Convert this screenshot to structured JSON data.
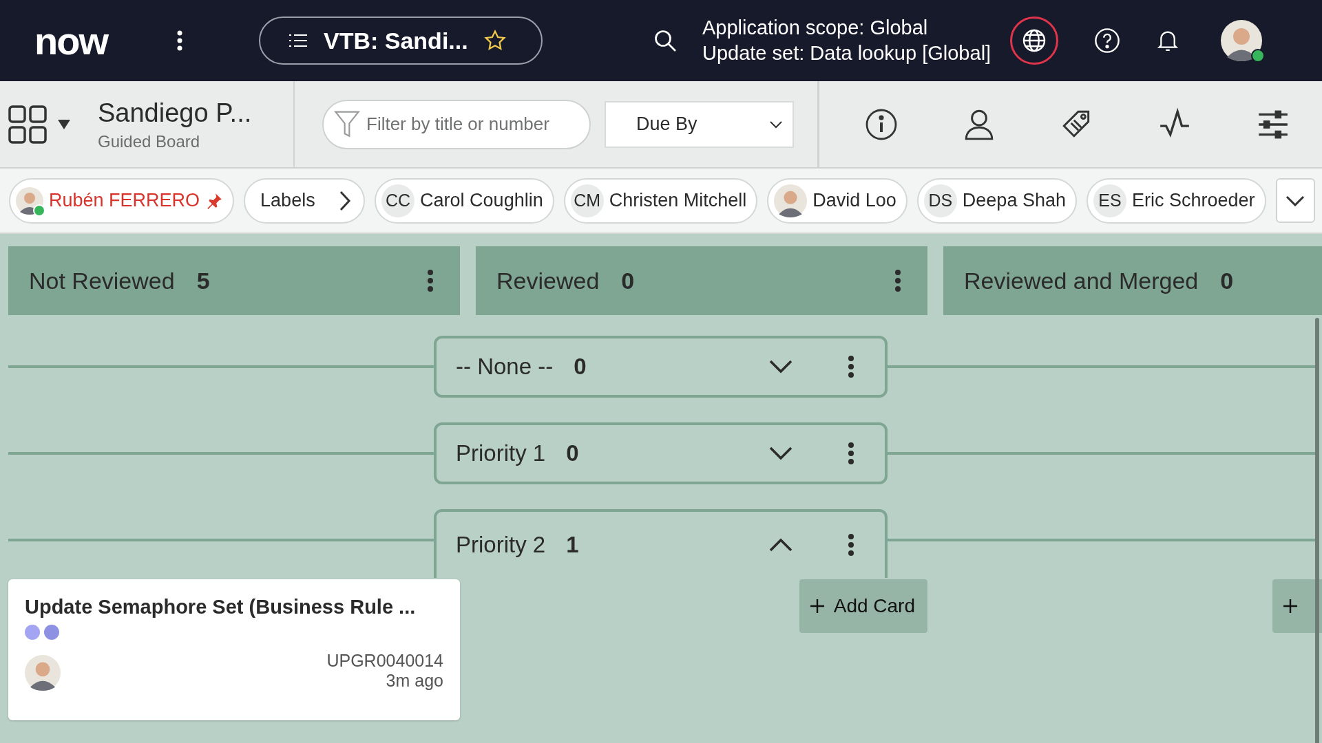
{
  "topbar": {
    "logo": "now",
    "title": "VTB: Sandi...",
    "scope_line": "Application scope: Global",
    "update_set_line": "Update set: Data lookup [Global]",
    "user_online": true
  },
  "board_header": {
    "name": "Sandiego P...",
    "type": "Guided Board",
    "filter": {
      "placeholder": "Filter by title or number"
    },
    "sort": {
      "value": "Due By"
    }
  },
  "chips": [
    {
      "kind": "me",
      "label": "Rubén FERRERO",
      "pinned": true,
      "online": true
    },
    {
      "kind": "labels",
      "label": "Labels"
    },
    {
      "kind": "initials",
      "initials": "CC",
      "label": "Carol Coughlin"
    },
    {
      "kind": "initials",
      "initials": "CM",
      "label": "Christen Mitchell"
    },
    {
      "kind": "photo",
      "label": "David Loo"
    },
    {
      "kind": "initials",
      "initials": "DS",
      "label": "Deepa Shah"
    },
    {
      "kind": "initials",
      "initials": "ES",
      "label": "Eric Schroeder"
    }
  ],
  "board": {
    "columns": [
      {
        "name": "Not Reviewed",
        "count": "5",
        "cards": [
          {
            "title": "Update Semaphore Set (Business Rule ...",
            "labels": [
              {
                "color": "#a3a5f2"
              },
              {
                "color": "#8d90e3"
              }
            ],
            "number": "UPGR0040014",
            "time": "3m ago"
          }
        ]
      },
      {
        "name": "Reviewed",
        "count": "0",
        "add_card": {
          "label": "Add Card"
        }
      },
      {
        "name": "Reviewed and Merged",
        "count": "0",
        "add_card": {
          "clipped": true
        }
      }
    ],
    "swimlanes": [
      {
        "name": "-- None --",
        "count": "0",
        "expanded": false
      },
      {
        "name": "Priority 1",
        "count": "0",
        "expanded": false
      },
      {
        "name": "Priority 2",
        "count": "1",
        "expanded": true
      }
    ]
  }
}
